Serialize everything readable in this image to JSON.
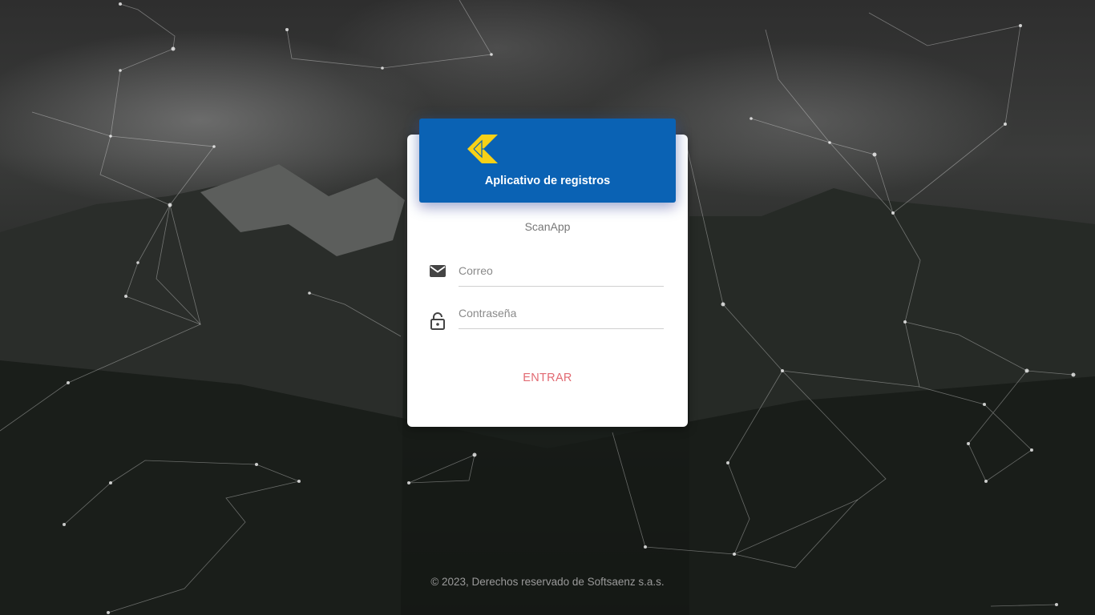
{
  "header": {
    "title": "Aplicativo de registros",
    "logo_icon": "ck-arrow-logo-icon",
    "color": "#0a62b4",
    "logo_color": "#f7d117"
  },
  "subtitle": "ScanApp",
  "form": {
    "email_placeholder": "Correo",
    "email_icon": "envelope-icon",
    "password_placeholder": "Contraseña",
    "password_icon": "lock-icon",
    "submit_label": "ENTRAR",
    "submit_color": "#e26a72"
  },
  "footer": {
    "copyright": "© 2023, Derechos reservado de Softsaenz s.a.s."
  }
}
